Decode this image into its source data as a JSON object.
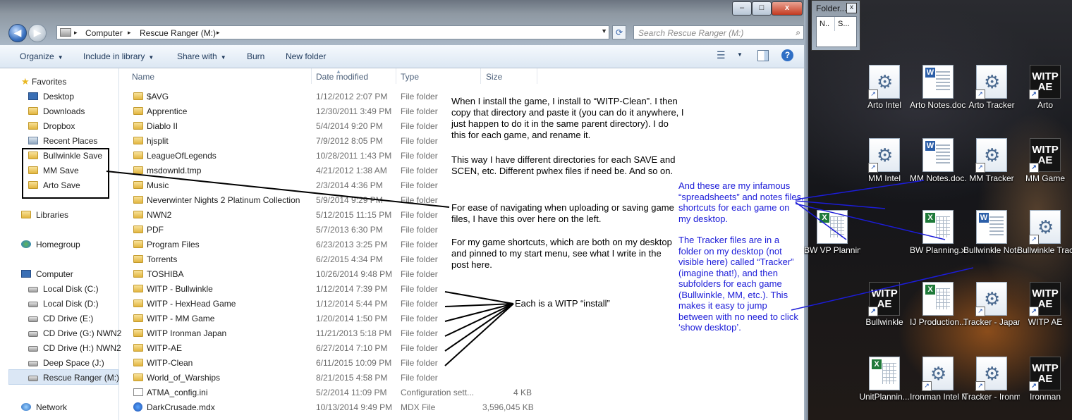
{
  "window": {
    "controls": {
      "minimize": "–",
      "maximize": "□",
      "close": "x"
    },
    "nav": {
      "back": "◀",
      "forward": "▶"
    },
    "address": {
      "crumbs": [
        "Computer",
        "Rescue Ranger (M:)"
      ],
      "separator": "▸"
    },
    "search": {
      "placeholder": "Search Rescue Ranger (M:)"
    }
  },
  "toolbar": {
    "organize": "Organize",
    "include": "Include in library",
    "share": "Share with",
    "burn": "Burn",
    "new_folder": "New folder"
  },
  "nav_pane": {
    "favorites": "Favorites",
    "favorite_items": [
      "Desktop",
      "Downloads",
      "Dropbox",
      "Recent Places",
      "Bullwinkle Save",
      "MM Save",
      "Arto Save"
    ],
    "libraries": "Libraries",
    "homegroup": "Homegroup",
    "computer": "Computer",
    "drives": [
      "Local Disk (C:)",
      "Local Disk (D:)",
      "CD Drive (E:)",
      "CD Drive (G:) NWN2",
      "CD Drive (H:) NWN2",
      "Deep Space (J:)",
      "Rescue Ranger (M:)"
    ],
    "network": "Network"
  },
  "columns": {
    "name": "Name",
    "date": "Date modified",
    "type": "Type",
    "size": "Size"
  },
  "files": [
    {
      "name": "$AVG",
      "date": "1/12/2012 2:07 PM",
      "type": "File folder",
      "size": ""
    },
    {
      "name": "Apprentice",
      "date": "12/30/2011 3:49 PM",
      "type": "File folder",
      "size": ""
    },
    {
      "name": "Diablo II",
      "date": "5/4/2014 9:20 PM",
      "type": "File folder",
      "size": ""
    },
    {
      "name": "hjsplit",
      "date": "7/9/2012 8:05 PM",
      "type": "File folder",
      "size": ""
    },
    {
      "name": "LeagueOfLegends",
      "date": "10/28/2011 1:43 PM",
      "type": "File folder",
      "size": ""
    },
    {
      "name": "msdownld.tmp",
      "date": "4/21/2012 1:38 AM",
      "type": "File folder",
      "size": ""
    },
    {
      "name": "Music",
      "date": "2/3/2014 4:36 PM",
      "type": "File folder",
      "size": ""
    },
    {
      "name": "Neverwinter Nights 2 Platinum Collection",
      "date": "5/9/2014 9:29 PM",
      "type": "File folder",
      "size": ""
    },
    {
      "name": "NWN2",
      "date": "5/12/2015 11:15 PM",
      "type": "File folder",
      "size": ""
    },
    {
      "name": "PDF",
      "date": "5/7/2013 6:30 PM",
      "type": "File folder",
      "size": ""
    },
    {
      "name": "Program Files",
      "date": "6/23/2013 3:25 PM",
      "type": "File folder",
      "size": ""
    },
    {
      "name": "Torrents",
      "date": "6/2/2015 4:34 PM",
      "type": "File folder",
      "size": ""
    },
    {
      "name": "TOSHIBA",
      "date": "10/26/2014 9:48 PM",
      "type": "File folder",
      "size": ""
    },
    {
      "name": "WITP - Bullwinkle",
      "date": "1/12/2014 7:39 PM",
      "type": "File folder",
      "size": ""
    },
    {
      "name": "WITP - HexHead Game",
      "date": "1/12/2014 5:44 PM",
      "type": "File folder",
      "size": ""
    },
    {
      "name": "WITP - MM Game",
      "date": "1/20/2014 1:50 PM",
      "type": "File folder",
      "size": ""
    },
    {
      "name": "WITP Ironman Japan",
      "date": "11/21/2013 5:18 PM",
      "type": "File folder",
      "size": ""
    },
    {
      "name": "WITP-AE",
      "date": "6/27/2014 7:10 PM",
      "type": "File folder",
      "size": ""
    },
    {
      "name": "WITP-Clean",
      "date": "6/11/2015 10:09 PM",
      "type": "File folder",
      "size": ""
    },
    {
      "name": "World_of_Warships",
      "date": "8/21/2015 4:58 PM",
      "type": "File folder",
      "size": ""
    },
    {
      "name": "ATMA_config.ini",
      "date": "5/2/2014 11:09 PM",
      "type": "Configuration sett...",
      "size": "4 KB"
    },
    {
      "name": "DarkCrusade.mdx",
      "date": "10/13/2014 9:49 PM",
      "type": "MDX File",
      "size": "3,596,045 KB"
    }
  ],
  "annotations": {
    "p1": "When I install the game, I install to “WITP-Clean”. I then copy that directory and paste it (you can do it anywhere, I just happen to do it in the same parent directory). I do this for each game, and rename it.",
    "p2": "This way I have different directories for each SAVE and SCEN, etc. Different pwhex files if need be. And so on.",
    "p3": "For ease of navigating when uploading or saving game files, I have this over here on the left.",
    "p4": "For my game shortcuts, which are both on my desktop and pinned to my start menu, see what I write in the post here.",
    "install_note": "Each is a WITP “install”",
    "blue1": "And these are my infamous “spreadsheets” and notes files, shortcuts for each game on my desktop.",
    "blue2": "The Tracker files are in a folder on my desktop (not visible here) called “Tracker” (imagine that!), and then subfolders for each game (Bullwinkle, MM, etc.). This makes it easy to jump between with no need to click ‘show desktop’."
  },
  "folder_window": {
    "title": "Folder...",
    "col1": "N..",
    "col2": "S..."
  },
  "desktop_icons": [
    {
      "label": "Arto Intel",
      "kind": "exe"
    },
    {
      "label": "Arto Notes.docx",
      "kind": "doc"
    },
    {
      "label": "Arto Tracker",
      "kind": "exe"
    },
    {
      "label": "Arto",
      "kind": "witp"
    },
    {
      "label": "MM Intel",
      "kind": "exe"
    },
    {
      "label": "MM Notes.doc...",
      "kind": "doc"
    },
    {
      "label": "MM Tracker",
      "kind": "exe"
    },
    {
      "label": "MM Game",
      "kind": "witp"
    },
    {
      "label": "BW VP Planning.xlsx",
      "kind": "xls"
    },
    {
      "label": "BW Planning.xlsx",
      "kind": "xls"
    },
    {
      "label": "Bullwinkle Notes.docx",
      "kind": "doc"
    },
    {
      "label": "Bullwinkle Tracker",
      "kind": "exe"
    },
    {
      "label": "Bullwinkle",
      "kind": "witp"
    },
    {
      "label": "IJ Production...",
      "kind": "xls"
    },
    {
      "label": "Tracker - Japan",
      "kind": "exe"
    },
    {
      "label": "WITP AE",
      "kind": "witp"
    },
    {
      "label": "UnitPlannin...",
      "kind": "xls"
    },
    {
      "label": "Ironman Intel Monkey",
      "kind": "exe"
    },
    {
      "label": "Tracker - Ironman",
      "kind": "exe"
    },
    {
      "label": "Ironman",
      "kind": "witp"
    }
  ],
  "witp_logo": "WITP AE"
}
